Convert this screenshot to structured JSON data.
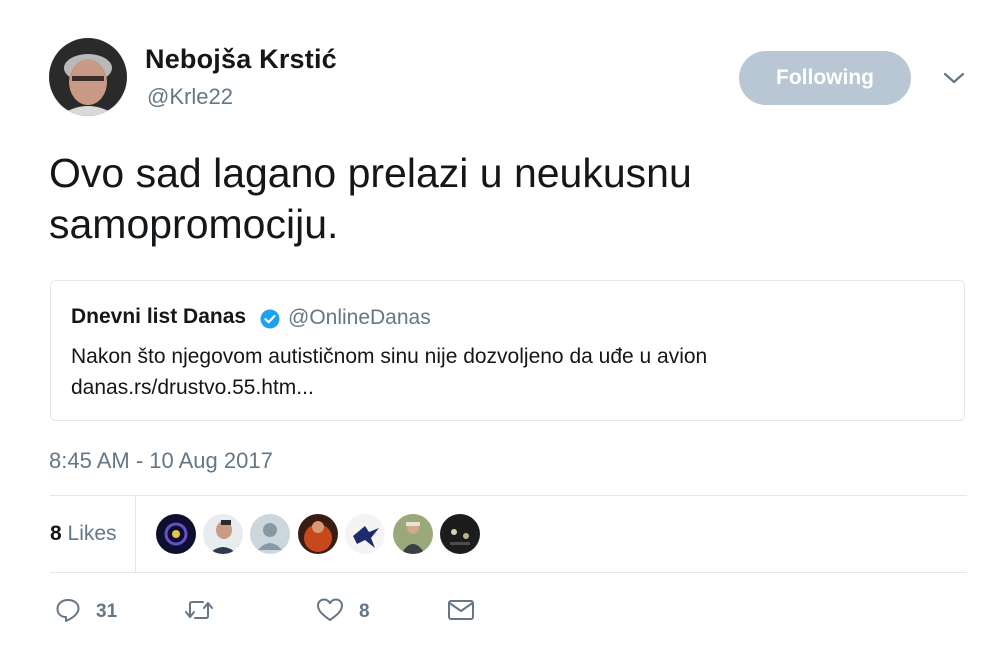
{
  "author": {
    "name": "Nebojša Krstić",
    "handle": "@Krle22"
  },
  "follow_button": {
    "label": "Following"
  },
  "tweet": {
    "text": "Ovo sad lagano prelazi u neukusnu samopromociju."
  },
  "quoted_tweet": {
    "name": "Dnevni list Danas",
    "verified": true,
    "handle": "@OnlineDanas",
    "text": "Nakon što njegovom autističnom sinu nije dozvoljeno da uđe u avion danas.rs/drustvo.55.htm..."
  },
  "timestamp": "8:45 AM - 10 Aug 2017",
  "likes": {
    "count": "8",
    "label": "Likes"
  },
  "actions": {
    "reply_count": "31",
    "retweet_count": "",
    "like_count": "8"
  },
  "colors": {
    "primary_text": "#14171a",
    "secondary_text": "#657786",
    "follow_button_bg": "#b8c7d3",
    "verified_badge": "#1da1f2",
    "divider": "#e1e8ed"
  },
  "icons": [
    "chevron-down-icon",
    "verified-badge-icon",
    "reply-icon",
    "retweet-icon",
    "heart-icon",
    "mail-icon"
  ]
}
